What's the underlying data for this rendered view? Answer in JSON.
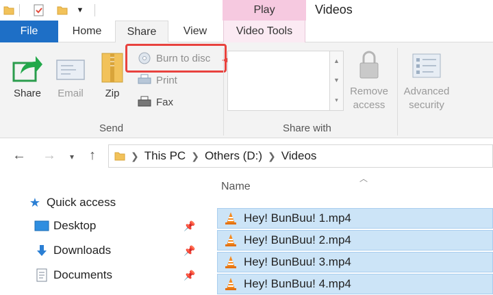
{
  "title_bar": {
    "context_tab": "Play",
    "window_title": "Videos"
  },
  "tabs": [
    {
      "label": "File",
      "active": false
    },
    {
      "label": "Home",
      "active": false
    },
    {
      "label": "Share",
      "active": true
    },
    {
      "label": "View",
      "active": false
    },
    {
      "label": "Video Tools",
      "active": false
    }
  ],
  "ribbon": {
    "send_group": {
      "label": "Send",
      "share": "Share",
      "email": "Email",
      "zip": "Zip",
      "burn_to_disc": "Burn to disc",
      "print": "Print",
      "fax": "Fax"
    },
    "share_with_group": {
      "label": "Share with",
      "remove_access": "Remove access",
      "advanced_security": "Advanced security"
    }
  },
  "address_bar": {
    "breadcrumbs": [
      "This PC",
      "Others (D:)",
      "Videos"
    ]
  },
  "nav_pane": {
    "quick_access": "Quick access",
    "items": [
      {
        "label": "Desktop",
        "pinned": true
      },
      {
        "label": "Downloads",
        "pinned": true
      },
      {
        "label": "Documents",
        "pinned": true
      }
    ]
  },
  "file_list": {
    "column_name": "Name",
    "files": [
      {
        "name": "Hey! BunBuu! 1.mp4",
        "selected": true
      },
      {
        "name": "Hey! BunBuu! 2.mp4",
        "selected": true
      },
      {
        "name": "Hey! BunBuu! 3.mp4",
        "selected": true
      },
      {
        "name": "Hey! BunBuu! 4.mp4",
        "selected": true
      }
    ]
  },
  "colors": {
    "file_tab": "#1e6fc6",
    "context_play": "#f6c9e0",
    "highlight_red": "#e8423e",
    "selection": "#cce4f7",
    "share_arrow": "#22a84a"
  },
  "icons": {
    "share": "share-arrow-icon",
    "email": "envelope-icon",
    "zip": "zip-folder-icon",
    "burn": "disc-icon",
    "print": "printer-icon",
    "fax": "fax-icon",
    "remove_access": "padlock-icon",
    "advanced_security": "security-checklist-icon",
    "file": "vlc-cone-icon"
  }
}
